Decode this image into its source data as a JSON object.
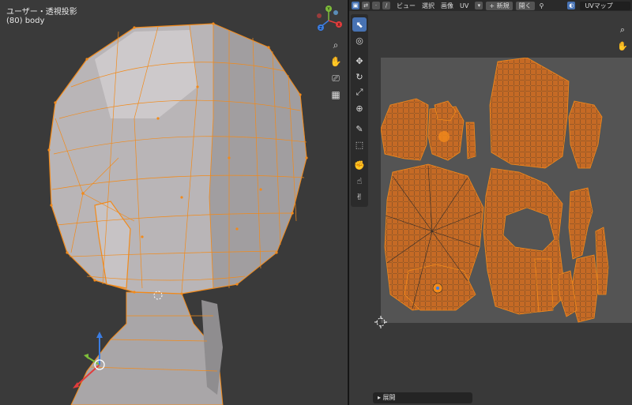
{
  "viewport": {
    "title": "ユーザー・透視投影",
    "object_label": "(80) body",
    "gizmo_axes": [
      "Y",
      "Z",
      "X"
    ],
    "tools": [
      "zoom-icon",
      "hand-icon",
      "camera-icon",
      "grid-icon"
    ]
  },
  "uv_editor": {
    "menus": [
      "ビュー",
      "選択",
      "画像",
      "UV"
    ],
    "new_label": "+ 新規",
    "open_label": "開く",
    "uvmap_label": "UVマップ",
    "footer_label": "▸ 展開",
    "tools": [
      "select-icon",
      "cursor-icon",
      "move-icon",
      "rotate-icon",
      "scale-icon",
      "transform-icon",
      "annotate-icon",
      "cube-icon",
      "grab-icon",
      "relax-icon",
      "pinch-icon"
    ]
  },
  "colors": {
    "mesh_edge": "#f28a1a",
    "mesh_fill": "#b5b1b3",
    "uv_fill": "#c56a25",
    "active_tool": "#4772b3",
    "axis_x": "#e23c3c",
    "axis_y": "#7ebd3a",
    "axis_z": "#3b7de2"
  }
}
